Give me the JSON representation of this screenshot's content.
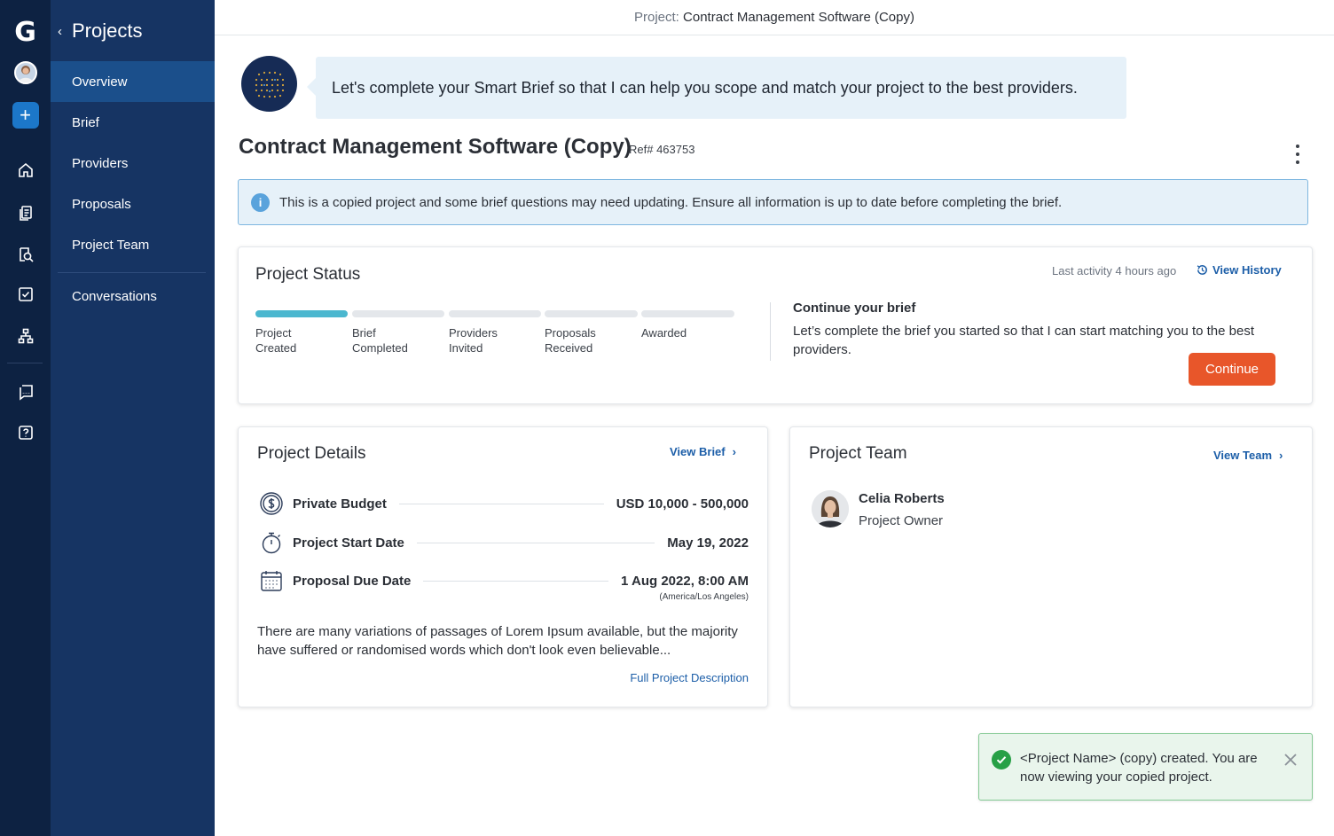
{
  "app": {
    "logo_letter": "G",
    "colors": {
      "rail": "#0d2242",
      "nav": "#163463",
      "nav_active": "#1b4f8b",
      "accent": "#e8562a",
      "link": "#1c5ea8",
      "progress": "#4bb7cf",
      "success": "#27a046"
    }
  },
  "rail": {
    "icons": [
      "logo-icon",
      "user-avatar",
      "add-icon",
      "home-icon",
      "documents-icon",
      "search-document-icon",
      "checklist-icon",
      "org-chart-icon",
      "chat-icon",
      "help-icon"
    ]
  },
  "nav": {
    "back_label": "‹",
    "title": "Projects",
    "items": [
      {
        "label": "Overview",
        "active": true
      },
      {
        "label": "Brief"
      },
      {
        "label": "Providers"
      },
      {
        "label": "Proposals"
      },
      {
        "label": "Project Team"
      },
      {
        "label": "Conversations"
      }
    ]
  },
  "header": {
    "prefix": "Project: ",
    "project_name": "Contract Management Software (Copy)"
  },
  "assistant": {
    "message": "Let's complete your Smart Brief so that I can help you scope and match your project to the best providers."
  },
  "project": {
    "title": "Contract Management Software (Copy)",
    "ref": "Ref# 463753"
  },
  "banner": {
    "icon": "i",
    "text": "This is a copied project and some brief questions may need updating. Ensure all information is up to date before completing the brief."
  },
  "status": {
    "title": "Project Status",
    "last_activity": "Last activity 4 hours ago",
    "view_history": "View History",
    "steps_completed": 1,
    "steps": [
      {
        "line1": "Project",
        "line2": "Created"
      },
      {
        "line1": "Brief",
        "line2": "Completed"
      },
      {
        "line1": "Providers",
        "line2": "Invited"
      },
      {
        "line1": "Proposals",
        "line2": "Received"
      },
      {
        "line1": "Awarded",
        "line2": ""
      }
    ],
    "continue_title": "Continue your brief",
    "continue_text": "Let’s complete the brief you started so that I can start matching you to the best providers.",
    "continue_button": "Continue"
  },
  "details": {
    "title": "Project Details",
    "view_brief": "View Brief",
    "rows": [
      {
        "label": "Private Budget",
        "value": "USD 10,000 - 500,000",
        "icon": "budget-icon"
      },
      {
        "label": "Project Start Date",
        "value": "May 19, 2022",
        "icon": "stopwatch-icon"
      },
      {
        "label": "Proposal Due Date",
        "value": "1 Aug 2022, 8:00 AM",
        "icon": "calendar-icon"
      }
    ],
    "timezone": "(America/Los Angeles)",
    "description": "There are many variations of passages of Lorem Ipsum available, but the majority have suffered or randomised words which don't look even believable...",
    "full_description": "Full Project Description"
  },
  "team": {
    "title": "Project Team",
    "view_team": "View Team",
    "members": [
      {
        "name": "Celia Roberts",
        "role": "Project Owner"
      }
    ]
  },
  "toast": {
    "message": "<Project Name> (copy) created. You are now viewing your copied project."
  }
}
